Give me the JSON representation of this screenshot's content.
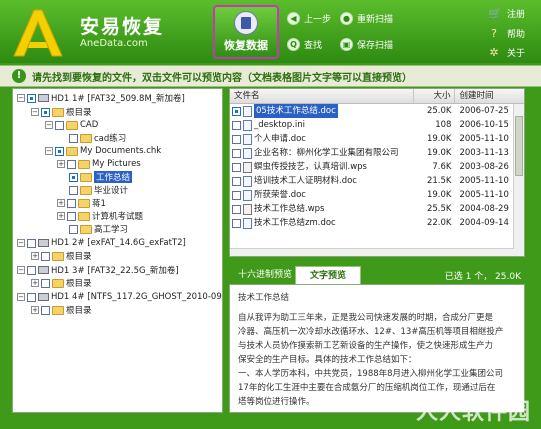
{
  "app": {
    "title": "安易恢复",
    "subtitle": "AneData.com"
  },
  "toolbar": {
    "recover": "恢复数据",
    "back": "上一步",
    "rescan": "重新扫描",
    "find": "查找",
    "save_scan": "保存扫描"
  },
  "side": {
    "register": "注册",
    "help": "帮助",
    "about": "关于"
  },
  "message": "请先找到要恢复的文件，双击文件可以预览内容（文档表格图片文字等可以直接预览）",
  "tree": [
    {
      "label": "HD1  1# [FAT32_509.8M_新加卷]"
    },
    {
      "label": "根目录"
    },
    {
      "label": "CAD"
    },
    {
      "label": "cad练习"
    },
    {
      "label": "My Documents.chk"
    },
    {
      "label": "My Pictures"
    },
    {
      "label": "工作总结"
    },
    {
      "label": "毕业设计"
    },
    {
      "label": "蒋1"
    },
    {
      "label": "计算机考试题"
    },
    {
      "label": "高工学习"
    },
    {
      "label": "HD1  2# [exFAT_14.6G_exFatT2]"
    },
    {
      "label": "根目录"
    },
    {
      "label": "HD1  3# [FAT32_22.5G_新加卷]"
    },
    {
      "label": "根目录"
    },
    {
      "label": "HD1  4# [NTFS_117.2G_GHOST_2010-09-03]"
    },
    {
      "label": "根目录"
    }
  ],
  "columns": {
    "name": "文件名",
    "size": "大小",
    "date": "创建时间"
  },
  "files": [
    {
      "name": "05技术工作总结.doc",
      "size": "25.0K",
      "date": "2006-07-25"
    },
    {
      "name": "_desktop.ini",
      "size": "108",
      "date": "2006-10-15"
    },
    {
      "name": "个人申请.doc",
      "size": "19.0K",
      "date": "2005-11-10"
    },
    {
      "name": "企业名称：柳州化学工业集团有限公司",
      "size": "19.0K",
      "date": "2003-11-13"
    },
    {
      "name": "螟虫传授技艺，认真培训.wps",
      "size": "7.6K",
      "date": "2003-08-26"
    },
    {
      "name": "培训技术工人证明材料.doc",
      "size": "21.5K",
      "date": "2005-11-10"
    },
    {
      "name": "所获荣誉.doc",
      "size": "19.0K",
      "date": "2005-11-10"
    },
    {
      "name": "技术工作总结.wps",
      "size": "25.5K",
      "date": "2004-08-29"
    },
    {
      "name": "技术工作总结zm.doc",
      "size": "22.0K",
      "date": "2004-09-14"
    }
  ],
  "preview": {
    "tab_hex": "十六进制预览",
    "tab_text": "文字预览",
    "selected_info": "已选 1 个， 25.0K",
    "lines": [
      "技术工作总结",
      "",
      "自从我评为助工三年来，正是我公司快速发展的时期，合成分厂更是",
      "冷器、高压机一次冷却水改循环水、12#、13#高压机等项目相继投产",
      "与技术人员协作摸索新工艺新设备的生产操作，使之快速形成生产力",
      "保安全的生产目标。具体的技术工作总结如下：",
      "一、本人学历本科，中共党员，1988年8月进入柳州化学工业集团公司",
      "17年的化工生涯中主要在合成氨分厂的压缩机岗位工作，现通过后在",
      "塔等岗位进行操作。"
    ]
  },
  "watermark": "人人软件园"
}
